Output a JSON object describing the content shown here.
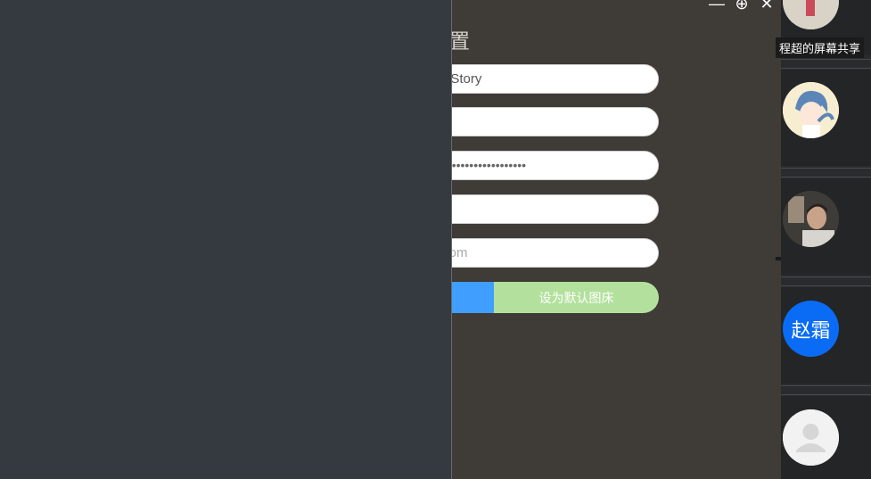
{
  "dialog": {
    "title": "设置",
    "fields": [
      {
        "value": "e-Story",
        "placeholder": ""
      },
      {
        "value": "",
        "placeholder": ""
      },
      {
        "value": "••••••••••••••••••••",
        "placeholder": ""
      },
      {
        "value": "",
        "placeholder": ""
      },
      {
        "value": "",
        "placeholder": ".com"
      }
    ],
    "primary_button_label": "",
    "default_bed_button_label": "设为默认图床",
    "window_controls": {
      "minimize": "—",
      "add": "⊕",
      "close": "✕"
    }
  },
  "participants": [
    {
      "name": "程超的屏幕共享",
      "avatar": "photo-avatar"
    },
    {
      "name": "",
      "avatar": "anime-avatar"
    },
    {
      "name": "",
      "avatar": "photo-avatar"
    },
    {
      "name": "",
      "avatar_text": "赵霜"
    },
    {
      "name": "",
      "avatar": "placeholder-person-icon"
    }
  ],
  "colors": {
    "left_bg": "#343a40",
    "dialog_bg": "#3f3b37",
    "primary_blue": "#409eff",
    "success_light": "#b3e19d",
    "avatar_blue": "#0a6cf5"
  }
}
